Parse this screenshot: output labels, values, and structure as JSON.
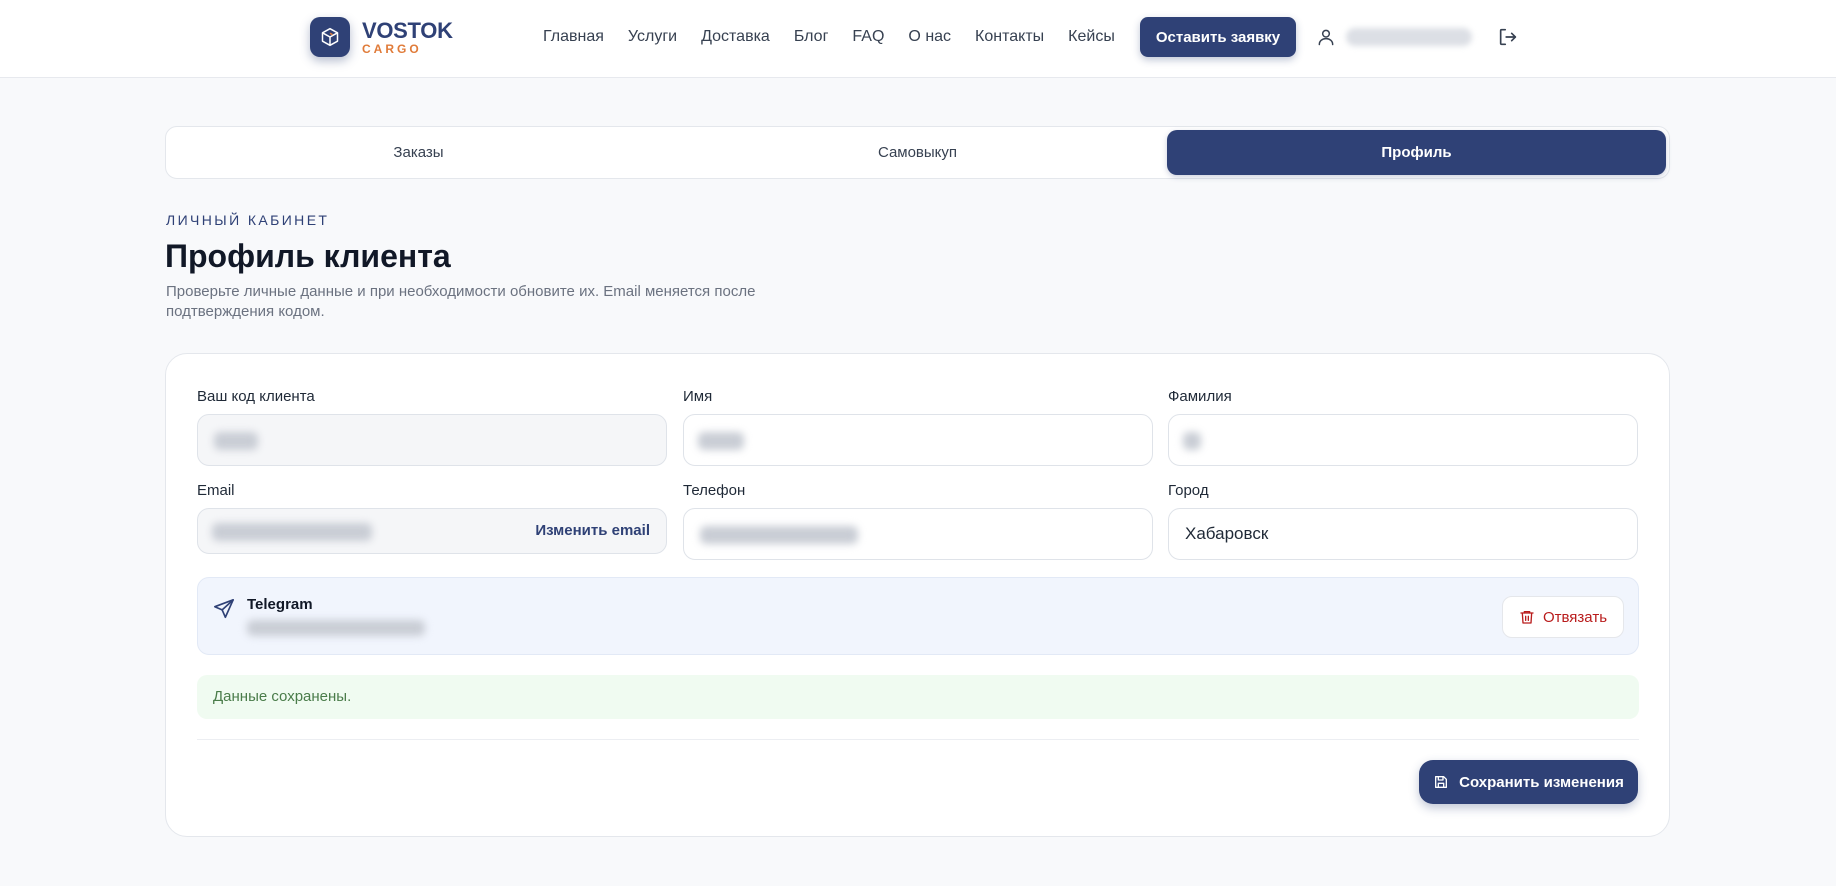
{
  "header": {
    "logo_word": "VOSTOK",
    "logo_sub": "CARGO",
    "nav": [
      "Главная",
      "Услуги",
      "Доставка",
      "Блог",
      "FAQ",
      "О нас",
      "Контакты",
      "Кейсы"
    ],
    "cta_label": "Оставить заявку",
    "icons": {
      "user": "user-icon",
      "logout": "logout-icon"
    }
  },
  "tabs": [
    {
      "label": "Заказы",
      "active": false
    },
    {
      "label": "Самовыкуп",
      "active": false
    },
    {
      "label": "Профиль",
      "active": true
    }
  ],
  "page": {
    "eyebrow": "ЛИЧНЫЙ КАБИНЕТ",
    "title": "Профиль клиента",
    "description": "Проверьте личные данные и при необходимости обновите их. Email меняется после подтверждения кодом."
  },
  "form": {
    "client_code_label": "Ваш код клиента",
    "first_name_label": "Имя",
    "last_name_label": "Фамилия",
    "email_label": "Email",
    "email_change_label": "Изменить email",
    "phone_label": "Телефон",
    "city_label": "Город",
    "city_value": "Хабаровск"
  },
  "telegram": {
    "title": "Telegram",
    "unlink_label": "Отвязать",
    "icon": "send-icon"
  },
  "status": {
    "message": "Данные сохранены."
  },
  "actions": {
    "save_label": "Сохранить изменения"
  },
  "colors": {
    "brand": "#2f4176",
    "accent": "#e07b39",
    "danger": "#b91c1c",
    "success_bg": "#f0fbf1"
  }
}
